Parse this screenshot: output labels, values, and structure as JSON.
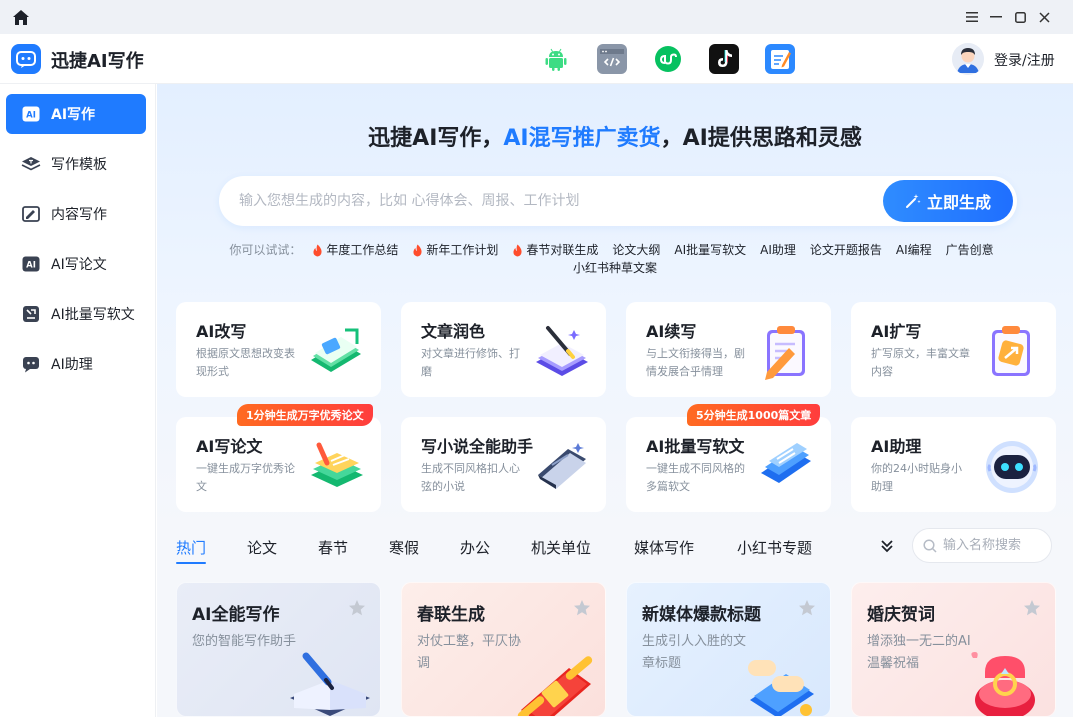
{
  "app": {
    "title": "迅捷AI写作",
    "login_label": "登录/注册",
    "platforms": [
      "android-icon",
      "code-icon",
      "miniprogram-icon",
      "tiktok-icon",
      "notepad-icon"
    ]
  },
  "sidebar": {
    "items": [
      {
        "label": "AI写作",
        "active": true,
        "icon": "ai-write-icon"
      },
      {
        "label": "写作模板",
        "active": false,
        "icon": "template-icon"
      },
      {
        "label": "内容写作",
        "active": false,
        "icon": "content-write-icon"
      },
      {
        "label": "AI写论文",
        "active": false,
        "icon": "ai-paper-icon"
      },
      {
        "label": "AI批量写软文",
        "active": false,
        "icon": "batch-write-icon"
      },
      {
        "label": "AI助理",
        "active": false,
        "icon": "assistant-icon"
      }
    ]
  },
  "hero": {
    "title_prefix": "迅捷AI写作，",
    "title_highlight": "AI混写推广卖货",
    "title_suffix": "，AI提供思路和灵感",
    "search_placeholder": "输入您想生成的内容，比如 心得体会、周报、工作计划",
    "generate_label": "立即生成",
    "try_label": "你可以试试：",
    "try_items": [
      {
        "label": "年度工作总结",
        "hot": true
      },
      {
        "label": "新年工作计划",
        "hot": true
      },
      {
        "label": "春节对联生成",
        "hot": true
      },
      {
        "label": "论文大纲",
        "hot": false
      },
      {
        "label": "AI批量写软文",
        "hot": false
      },
      {
        "label": "AI助理",
        "hot": false
      },
      {
        "label": "论文开题报告",
        "hot": false
      },
      {
        "label": "AI编程",
        "hot": false
      },
      {
        "label": "广告创意",
        "hot": false
      }
    ],
    "try_items_line2": [
      {
        "label": "小红书种草文案",
        "hot": false
      }
    ]
  },
  "features": [
    {
      "title": "AI改写",
      "desc": "根据原文思想改变表现形式"
    },
    {
      "title": "文章润色",
      "desc": "对文章进行修饰、打磨"
    },
    {
      "title": "AI续写",
      "desc": "与上文衔接得当，剧情发展合乎情理"
    },
    {
      "title": "AI扩写",
      "desc": "扩写原文，丰富文章内容"
    },
    {
      "title": "AI写论文",
      "desc": "一键生成万字优秀论文",
      "badge": "1分钟生成万字优秀论文"
    },
    {
      "title": "写小说全能助手",
      "desc": "生成不同风格扣人心弦的小说"
    },
    {
      "title": "AI批量写软文",
      "desc": "一键生成不同风格的多篇软文",
      "badge": "5分钟生成1000篇文章"
    },
    {
      "title": "AI助理",
      "desc": "你的24小时贴身小助理"
    }
  ],
  "tabs": {
    "items": [
      "热门",
      "论文",
      "春节",
      "寒假",
      "办公",
      "机关单位",
      "媒体写作",
      "小红书专题"
    ],
    "active_index": 0,
    "search_placeholder": "输入名称搜索"
  },
  "templates": [
    {
      "title": "AI全能写作",
      "desc": "您的智能写作助手",
      "bg": "#e7ebf5"
    },
    {
      "title": "春联生成",
      "desc": "对仗工整，平仄协调",
      "bg": "#fde9e6"
    },
    {
      "title": "新媒体爆款标题",
      "desc": "生成引人入胜的文章标题",
      "bg": "#e3effd"
    },
    {
      "title": "婚庆贺词",
      "desc": "增添独一无二的AI温馨祝福",
      "bg": "#fdeceb"
    }
  ],
  "colors": {
    "accent": "#1f7bff",
    "badge": "#ff4d2d"
  }
}
